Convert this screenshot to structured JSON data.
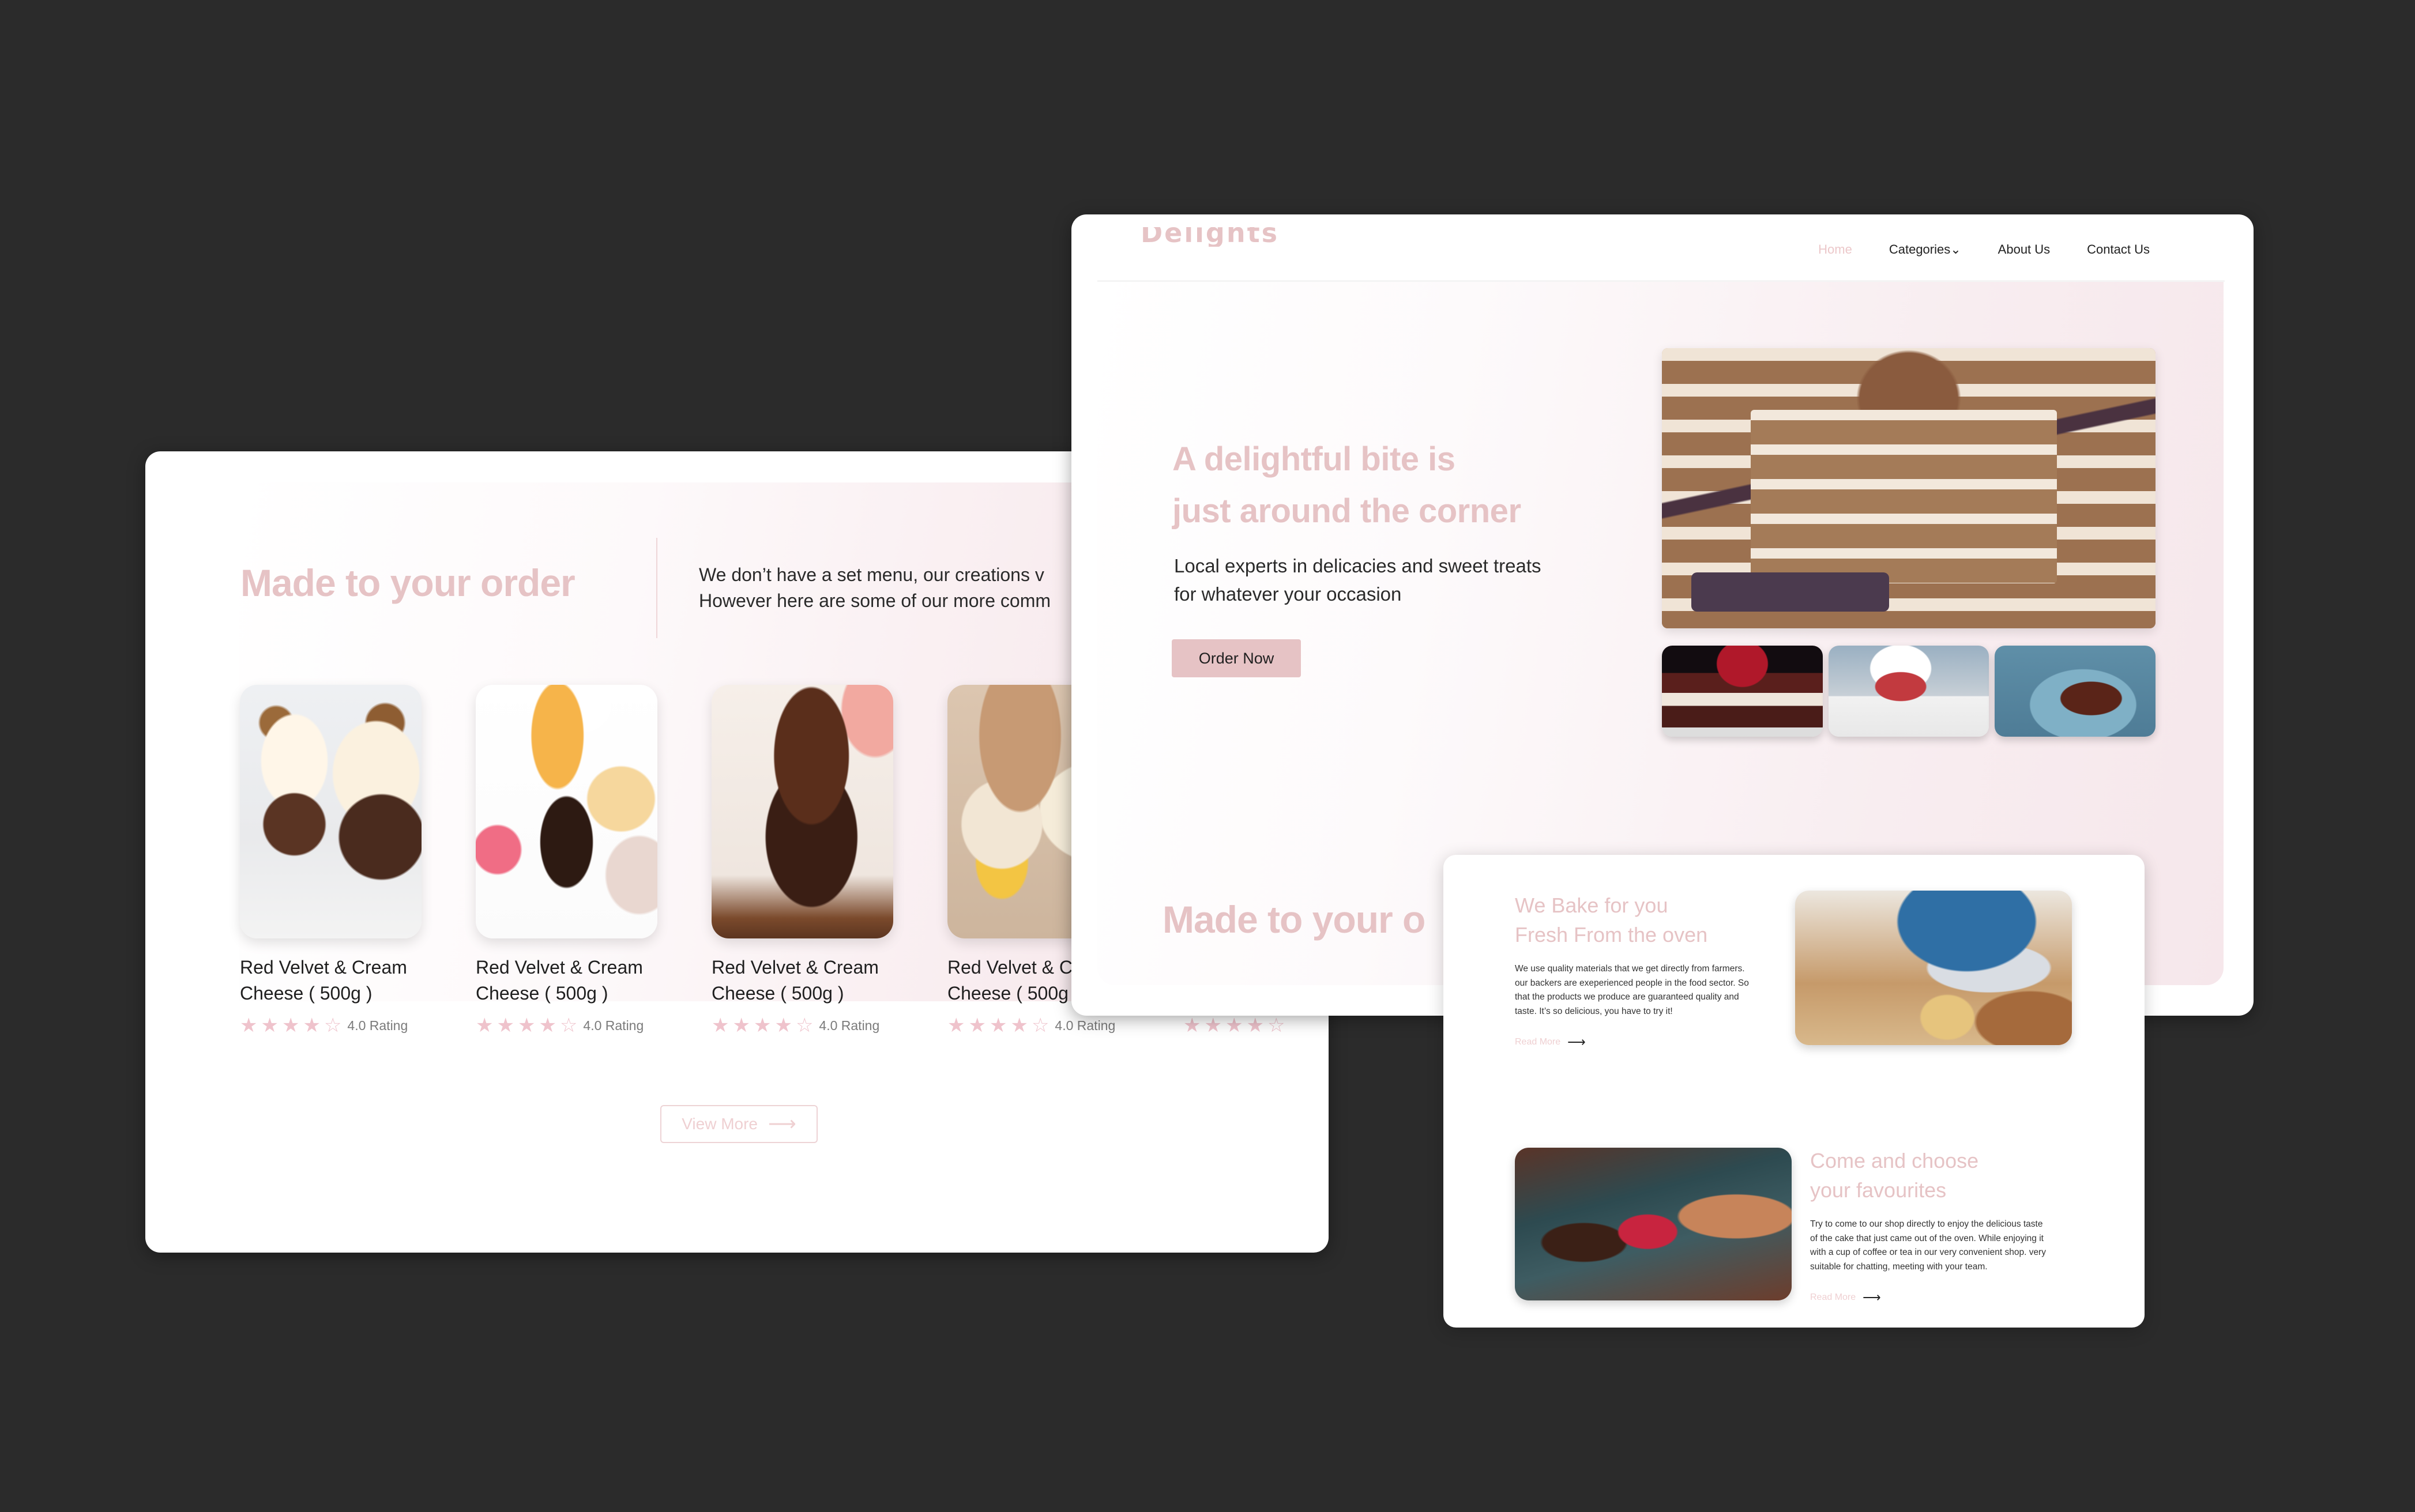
{
  "order_section": {
    "title": "Made to your order",
    "intro_lines": [
      "We don’t have a set menu, our creations v",
      "However here are some of our more comm"
    ],
    "products": [
      {
        "name_line1": "Red Velvet & Cream",
        "name_line2": "Cheese ( 500g )",
        "rating": 4.0,
        "max_rating": 5,
        "rating_label": "4.0 Rating",
        "image": "cupcakes"
      },
      {
        "name_line1": "Red Velvet & Cream",
        "name_line2": "Cheese ( 500g )",
        "rating": 4.0,
        "max_rating": 5,
        "rating_label": "4.0 Rating",
        "image": "assorted pastries"
      },
      {
        "name_line1": "Red Velvet & Cream",
        "name_line2": "Cheese ( 500g )",
        "rating": 4.0,
        "max_rating": 5,
        "rating_label": "4.0 Rating",
        "image": "brownies"
      },
      {
        "name_line1": "Red Velvet & C",
        "name_line2": "Cheese ( 500g",
        "rating": 4.0,
        "max_rating": 5,
        "rating_label": "4.0 Rating",
        "image": "cheesecakes"
      },
      {
        "name_line1": "",
        "name_line2": "",
        "rating": 4.0,
        "max_rating": 5,
        "rating_label": "",
        "image": ""
      }
    ],
    "view_more_label": "View More",
    "view_more_arrow": "⟶"
  },
  "hero": {
    "logo": "Delights",
    "nav": [
      {
        "label": "Home",
        "active": true
      },
      {
        "label": "Categories⌄",
        "active": false
      },
      {
        "label": "About Us",
        "active": false
      },
      {
        "label": "Contact Us",
        "active": false
      }
    ],
    "title_line1": "A delightful bite is",
    "title_line2": "just around the corner",
    "subtitle_line1": "Local experts in delicacies and sweet treats",
    "subtitle_line2": "for whatever your occasion",
    "cta_label": "Order Now",
    "main_image": "layered tiramisu cake slice",
    "thumbnails": [
      "berry chocolate cake",
      "red velvet cake",
      "chocolate cake slice"
    ],
    "section_preview": "Made to your o"
  },
  "about": {
    "blocks": [
      {
        "title_line1": "We Bake for you",
        "title_line2": "Fresh From the oven",
        "body": [
          "We use quality materials that we get directly from farmers.",
          "our backers are exeperienced people in the food sector. So",
          "that the products we produce are guaranteed quality and",
          "taste. It’s so delicious, you have to try it!"
        ],
        "read_more": "Read More",
        "arrow": "⟶",
        "image": "baker kneading dough"
      },
      {
        "title_line1": "Come and choose",
        "title_line2": "your favourites",
        "body": [
          "Try to come to our shop directly to enjoy the delicious taste",
          "of the cake that just came out of the oven. While enjoying it",
          "with a cup of coffee or tea in our very convenient shop. very",
          "suitable for chatting, meeting with your team."
        ],
        "read_more": "Read More",
        "arrow": "⟶",
        "image": "pastry display case"
      }
    ]
  },
  "colors": {
    "background": "#2b2b2b",
    "accent_pink": "#e6c3c5",
    "star_pink": "#efc3cc",
    "text_dark": "#222222"
  }
}
